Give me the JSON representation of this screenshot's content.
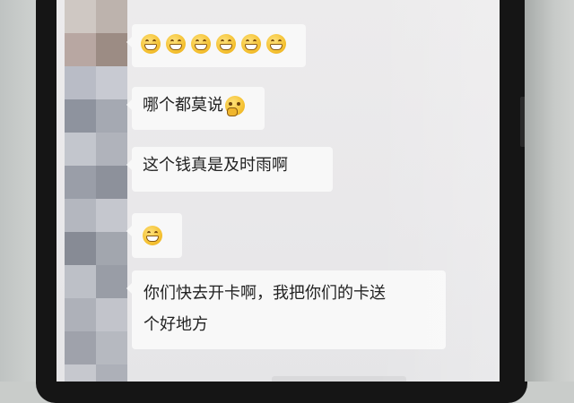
{
  "chat": {
    "messages": [
      {
        "type": "emoji",
        "emoji": "grin-emoji",
        "count": 6
      },
      {
        "type": "text",
        "text": "哪个都莫说",
        "trailing_emoji": "thinking-emoji"
      },
      {
        "type": "text",
        "text": "这个钱真是及时雨啊"
      },
      {
        "type": "emoji",
        "emoji": "grin-emoji",
        "count": 1
      },
      {
        "type": "text",
        "line1": "你们快去开卡啊，我把你们的卡送",
        "line2": "个好地方"
      }
    ]
  },
  "colors": {
    "screen_bg": "#ebebec",
    "bubble_bg": "#f8f8f8",
    "phone_frame": "#151515",
    "emoji_yellow": "#f5c233"
  }
}
